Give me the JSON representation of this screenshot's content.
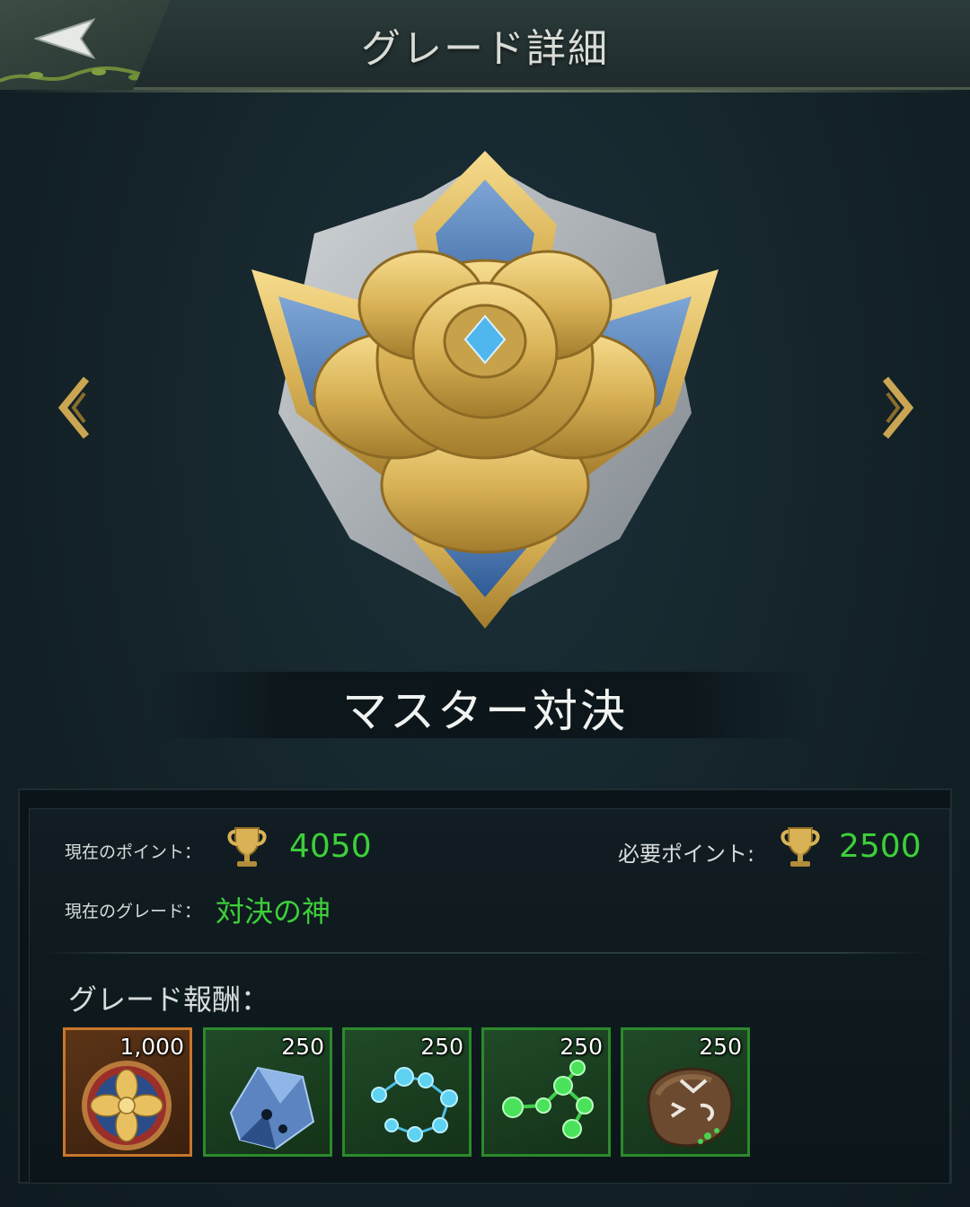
{
  "header": {
    "title": "グレード詳細"
  },
  "grade": {
    "name": "マスター対決"
  },
  "info": {
    "current_points_label": "現在のポイント：",
    "current_points_value": "4050",
    "required_points_label": "必要ポイント:",
    "required_points_value": "2500",
    "current_grade_label": "現在のグレード：",
    "current_grade_value": "対決の神"
  },
  "rewards": {
    "title": "グレード報酬：",
    "items": [
      {
        "icon": "gold-flower-medal-icon",
        "qty": "1,000"
      },
      {
        "icon": "blue-crystal-icon",
        "qty": "250"
      },
      {
        "icon": "blue-molecule-icon",
        "qty": "250"
      },
      {
        "icon": "green-molecule-icon",
        "qty": "250"
      },
      {
        "icon": "rune-stone-icon",
        "qty": "250"
      }
    ]
  },
  "colors": {
    "accent_green": "#3dcf3a",
    "gold": "#d9b256",
    "panel_bg": "#0b1418"
  }
}
